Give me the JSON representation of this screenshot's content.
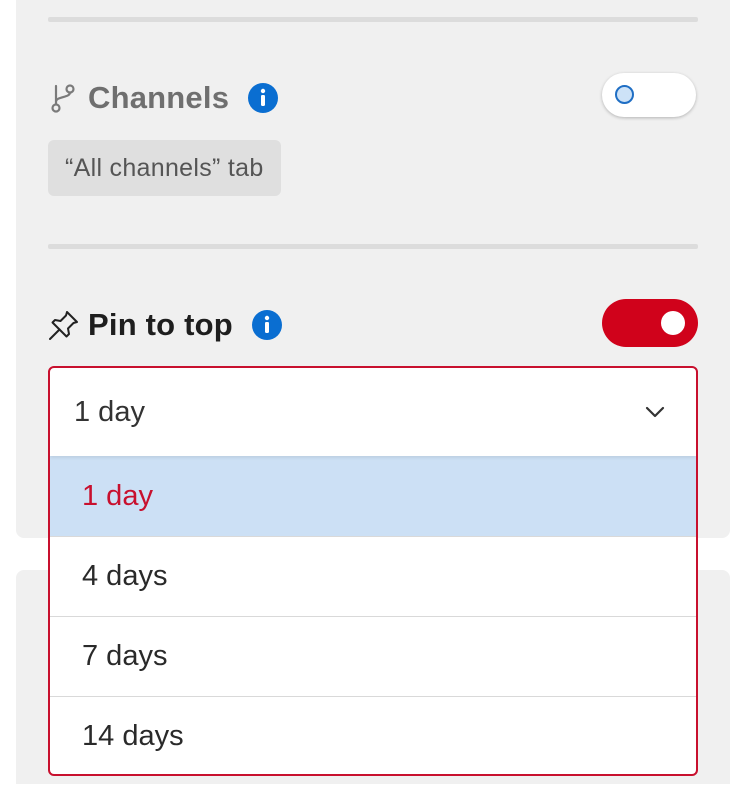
{
  "channels": {
    "title": "Channels",
    "icon": "branch-icon",
    "toggle_on": false,
    "chip_label": "“All channels” tab"
  },
  "pin": {
    "title": "Pin to top",
    "icon": "pin-icon",
    "toggle_on": true,
    "selected_value": "1 day",
    "options": [
      "1 day",
      "4 days",
      "7 days",
      "14 days"
    ]
  },
  "colors": {
    "accent_red": "#d0021b",
    "info_blue": "#0a6ed1",
    "selected_bg": "#cce0f5"
  }
}
